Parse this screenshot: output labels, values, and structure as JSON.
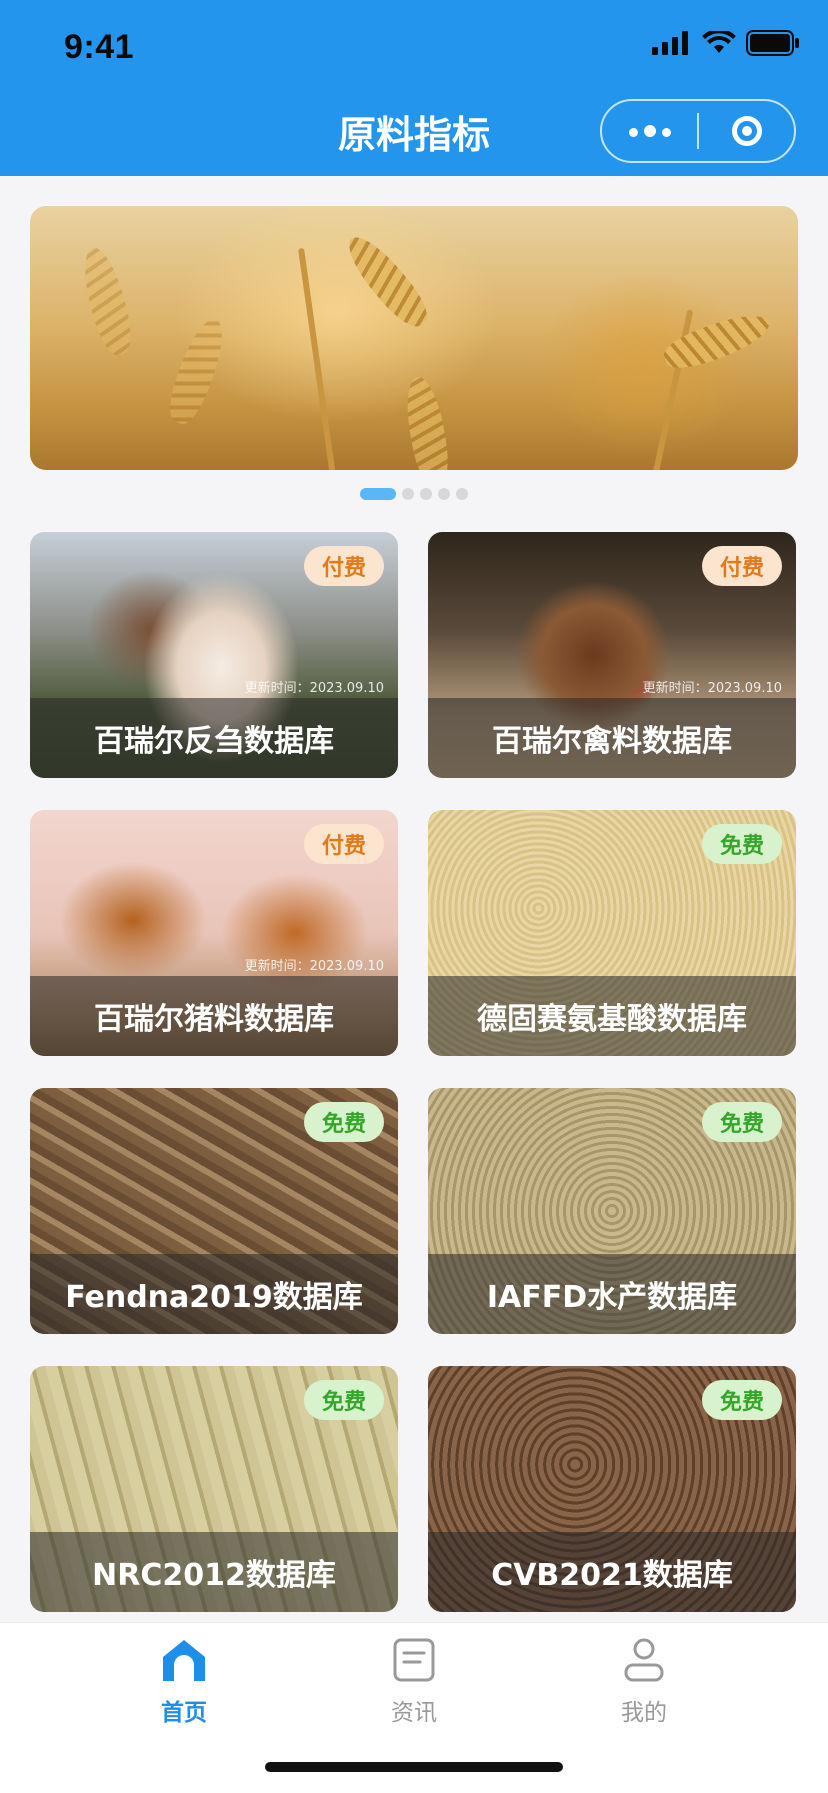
{
  "status_bar": {
    "time": "9:41"
  },
  "header": {
    "title": "原料指标"
  },
  "banner": {
    "indicator_count": 5,
    "active_index": 0
  },
  "cards": [
    {
      "title": "百瑞尔反刍数据库",
      "badge": "付费",
      "badge_type": "paid",
      "update": "更新时间：2023.09.10",
      "icon": "cow-photo"
    },
    {
      "title": "百瑞尔禽料数据库",
      "badge": "付费",
      "badge_type": "paid",
      "update": "更新时间：2023.09.10",
      "icon": "chicken-photo"
    },
    {
      "title": "百瑞尔猪料数据库",
      "badge": "付费",
      "badge_type": "paid",
      "update": "更新时间：2023.09.10",
      "icon": "pig-photo"
    },
    {
      "title": "德固赛氨基酸数据库",
      "badge": "免费",
      "badge_type": "free",
      "icon": "powder-photo"
    },
    {
      "title": "Fendna2019数据库",
      "badge": "免费",
      "badge_type": "free",
      "icon": "pellet-photo"
    },
    {
      "title": "IAFFD水产数据库",
      "badge": "免费",
      "badge_type": "free",
      "icon": "small-pellet-photo"
    },
    {
      "title": "NRC2012数据库",
      "badge": "免费",
      "badge_type": "free",
      "icon": "light-pellet-photo"
    },
    {
      "title": "CVB2021数据库",
      "badge": "免费",
      "badge_type": "free",
      "icon": "dark-pellet-photo"
    }
  ],
  "tabbar": {
    "items": [
      {
        "label": "首页",
        "icon": "home-icon",
        "active": true
      },
      {
        "label": "资讯",
        "icon": "news-icon",
        "active": false
      },
      {
        "label": "我的",
        "icon": "profile-icon",
        "active": false
      }
    ]
  },
  "colors": {
    "header_bg": "#2395ec",
    "active_tab": "#1e8fe8",
    "inactive_tab": "#999999",
    "paid_badge_text": "#e07b1c",
    "free_badge_text": "#34a62a"
  }
}
